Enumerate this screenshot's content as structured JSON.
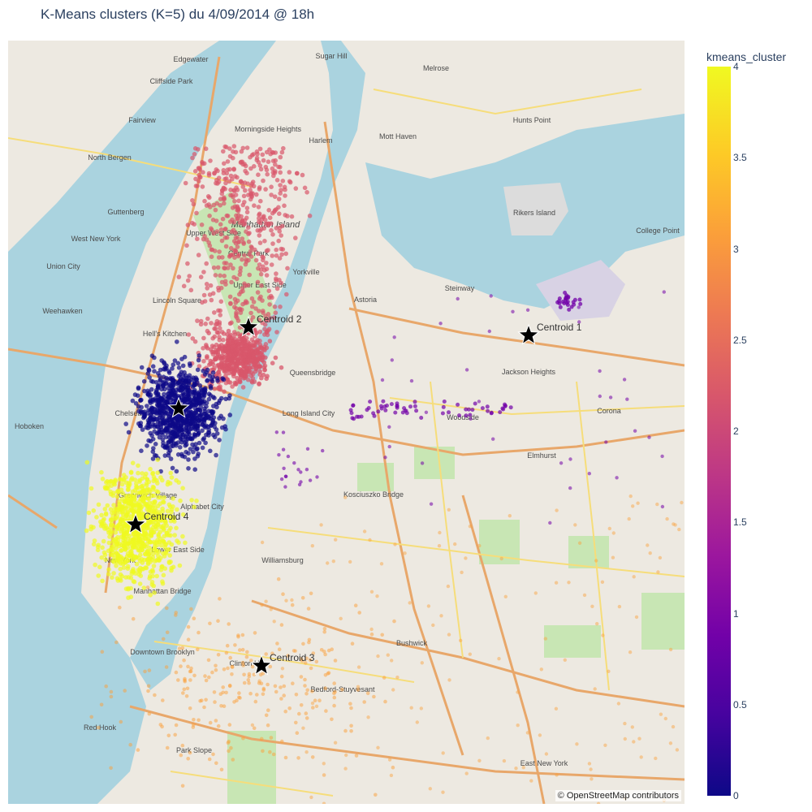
{
  "title": "K-Means clusters (K=5) du 4/09/2014 @ 18h",
  "attribution": "© OpenStreetMap contributors",
  "colorbar": {
    "title": "kmeans_cluster",
    "ticks": [
      "4",
      "3.5",
      "3",
      "2.5",
      "2",
      "1.5",
      "1",
      "0.5",
      "0"
    ],
    "tick_values": [
      4,
      3.5,
      3,
      2.5,
      2,
      1.5,
      1,
      0.5,
      0
    ],
    "range": [
      0,
      4
    ],
    "colorscale": [
      "#0d0887",
      "#46039f",
      "#7201a8",
      "#9c179e",
      "#bd3786",
      "#d8576b",
      "#ed7953",
      "#fb9f3a",
      "#fdca26",
      "#f0f921"
    ]
  },
  "centroids": [
    {
      "label": "Centroid 1",
      "cluster": 1
    },
    {
      "label": "Centroid 2",
      "cluster": 2
    },
    {
      "label": "Centroid 3",
      "cluster": 3
    },
    {
      "label": "Centroid 4",
      "cluster": 4
    }
  ],
  "place_labels": [
    "Sugar Hill",
    "Melrose",
    "Edgewater",
    "Cliffside Park",
    "Fairview",
    "Morningside Heights",
    "Harlem",
    "Mott Haven",
    "Hunts Point",
    "North Bergen",
    "Guttenberg",
    "West New York",
    "Manhattan Island",
    "Upper West Side",
    "Union City",
    "Central Park",
    "Upper East Side",
    "Rikers Island",
    "College Point",
    "Weehawken",
    "Lincoln Square",
    "Yorkville",
    "Astoria",
    "Steinway",
    "Hell's Kitchen",
    "Queensbridge",
    "Jackson Heights",
    "Long Island City",
    "Hoboken",
    "Chelsea",
    "Woodside",
    "Corona",
    "Elmhurst",
    "Greenwich Village",
    "Kosciuszko Bridge",
    "Alphabet City",
    "Lower East Side",
    "Williamsburg",
    "New York",
    "Manhattan Bridge",
    "Bushwick",
    "Downtown Brooklyn",
    "Clinton Hill",
    "Bedford-Stuyvesant",
    "Red Hook",
    "Park Slope",
    "East New York"
  ]
}
